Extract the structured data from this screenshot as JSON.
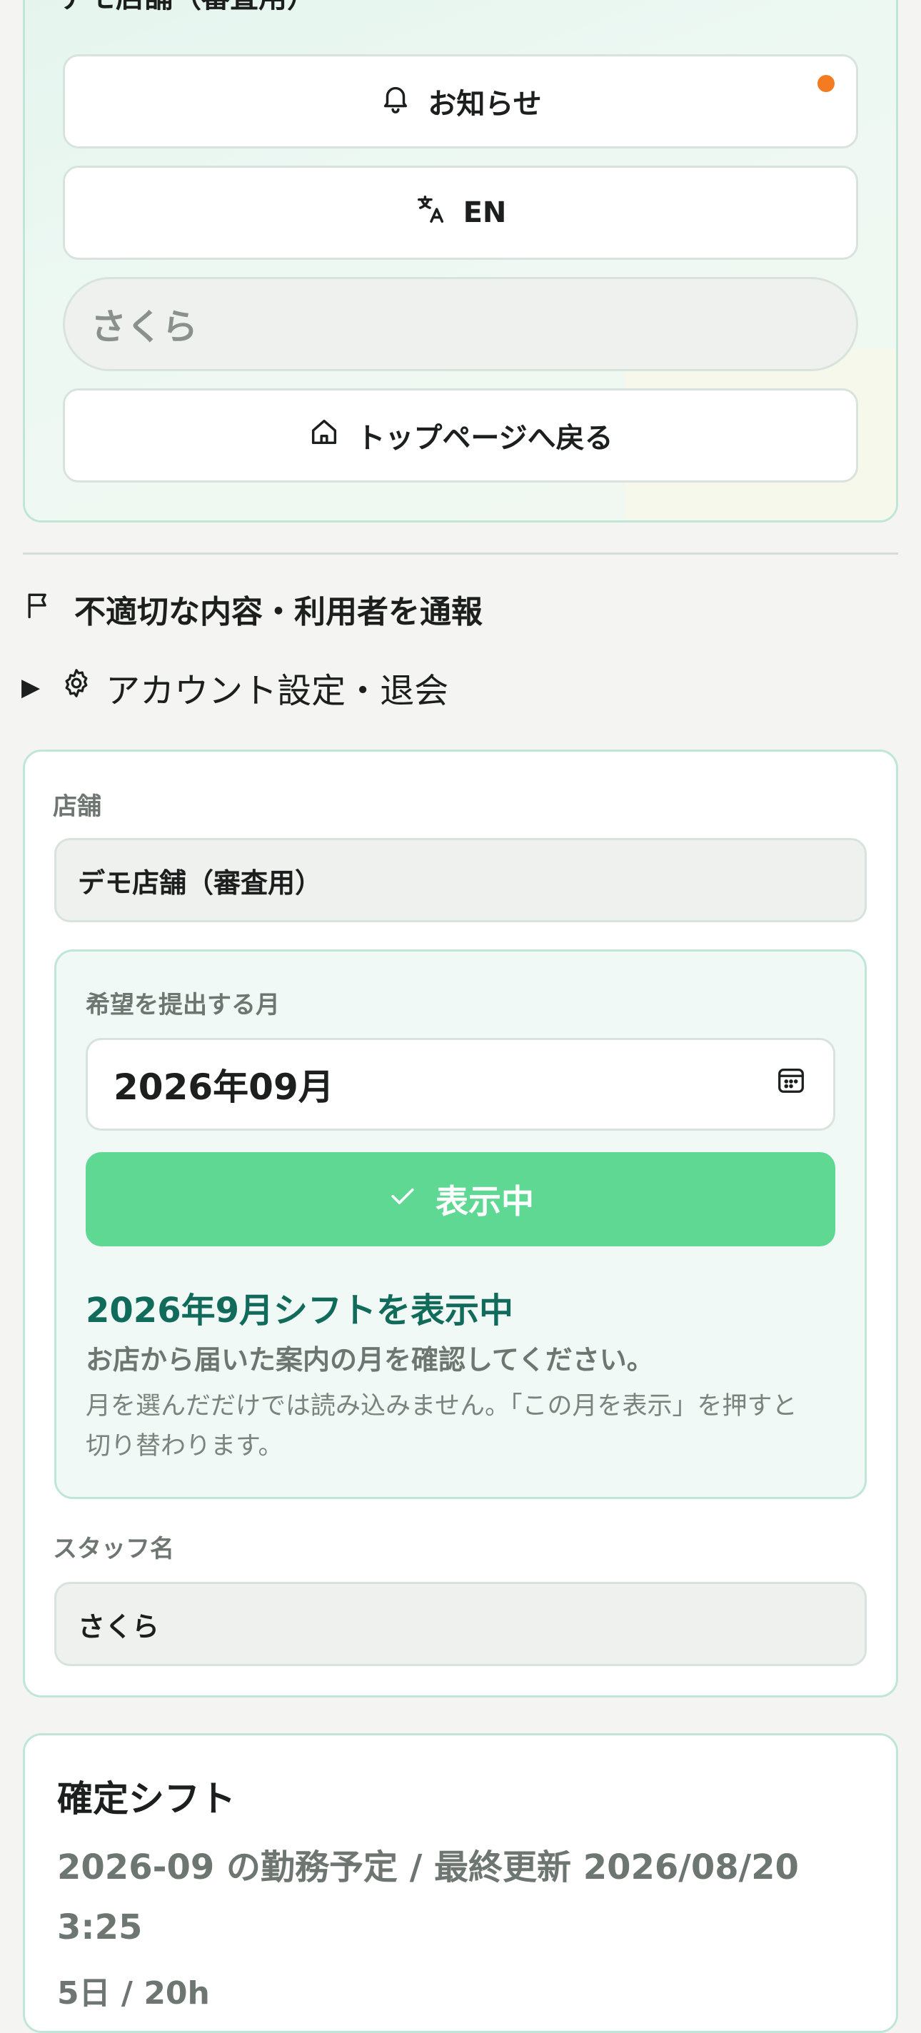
{
  "store_section": {
    "title_cut": "デモ店舗（審査用）",
    "notifications_label": "お知らせ",
    "language_label": "EN",
    "user_name": "さくら",
    "home_label": "トップページへ戻る"
  },
  "links": {
    "report_label": "不適切な内容・利用者を通報",
    "account_label": "アカウント設定・退会"
  },
  "form": {
    "store_label": "店舗",
    "store_value": "デモ店舗（審査用）",
    "month_label": "希望を提出する月",
    "month_value": "2026年09月",
    "show_button_label": "表示中",
    "status_title": "2026年9月シフトを表示中",
    "status_subtitle": "お店から届いた案内の月を確認してください。",
    "status_note": "月を選んだだけでは読み込みません。「この月を表示」を押すと切り替わります。",
    "staff_label": "スタッフ名",
    "staff_value": "さくら"
  },
  "shift": {
    "title": "確定シフト",
    "subtitle": "2026-09 の勤務予定 / 最終更新 2026/08/20 3:25",
    "count": "5日 / 20h"
  },
  "colors": {
    "accent_green": "#5fd894",
    "status_teal": "#116b5a",
    "notification_dot": "#f47b20"
  },
  "icons": [
    "bell-icon",
    "translate-icon",
    "home-icon",
    "flag-icon",
    "gear-icon",
    "calendar-icon",
    "check-icon"
  ]
}
